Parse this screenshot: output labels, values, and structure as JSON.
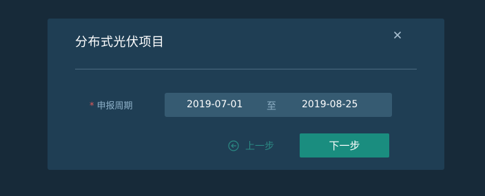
{
  "dialog": {
    "title": "分布式光伏项目",
    "close_icon": "close-icon"
  },
  "form": {
    "required_mark": "*",
    "period_label": "申报周期",
    "start_date": "2019-07-01",
    "range_separator": "至",
    "end_date": "2019-08-25"
  },
  "footer": {
    "prev_label": "上一步",
    "prev_icon": "arrow-left-circle-icon",
    "next_label": "下一步"
  },
  "colors": {
    "page_background": "#172a39",
    "dialog_background": "#1f3e54",
    "input_background": "#365b72",
    "primary_button": "#1a8d7f",
    "prev_text": "#2b8a84",
    "required": "#e15a5a"
  }
}
